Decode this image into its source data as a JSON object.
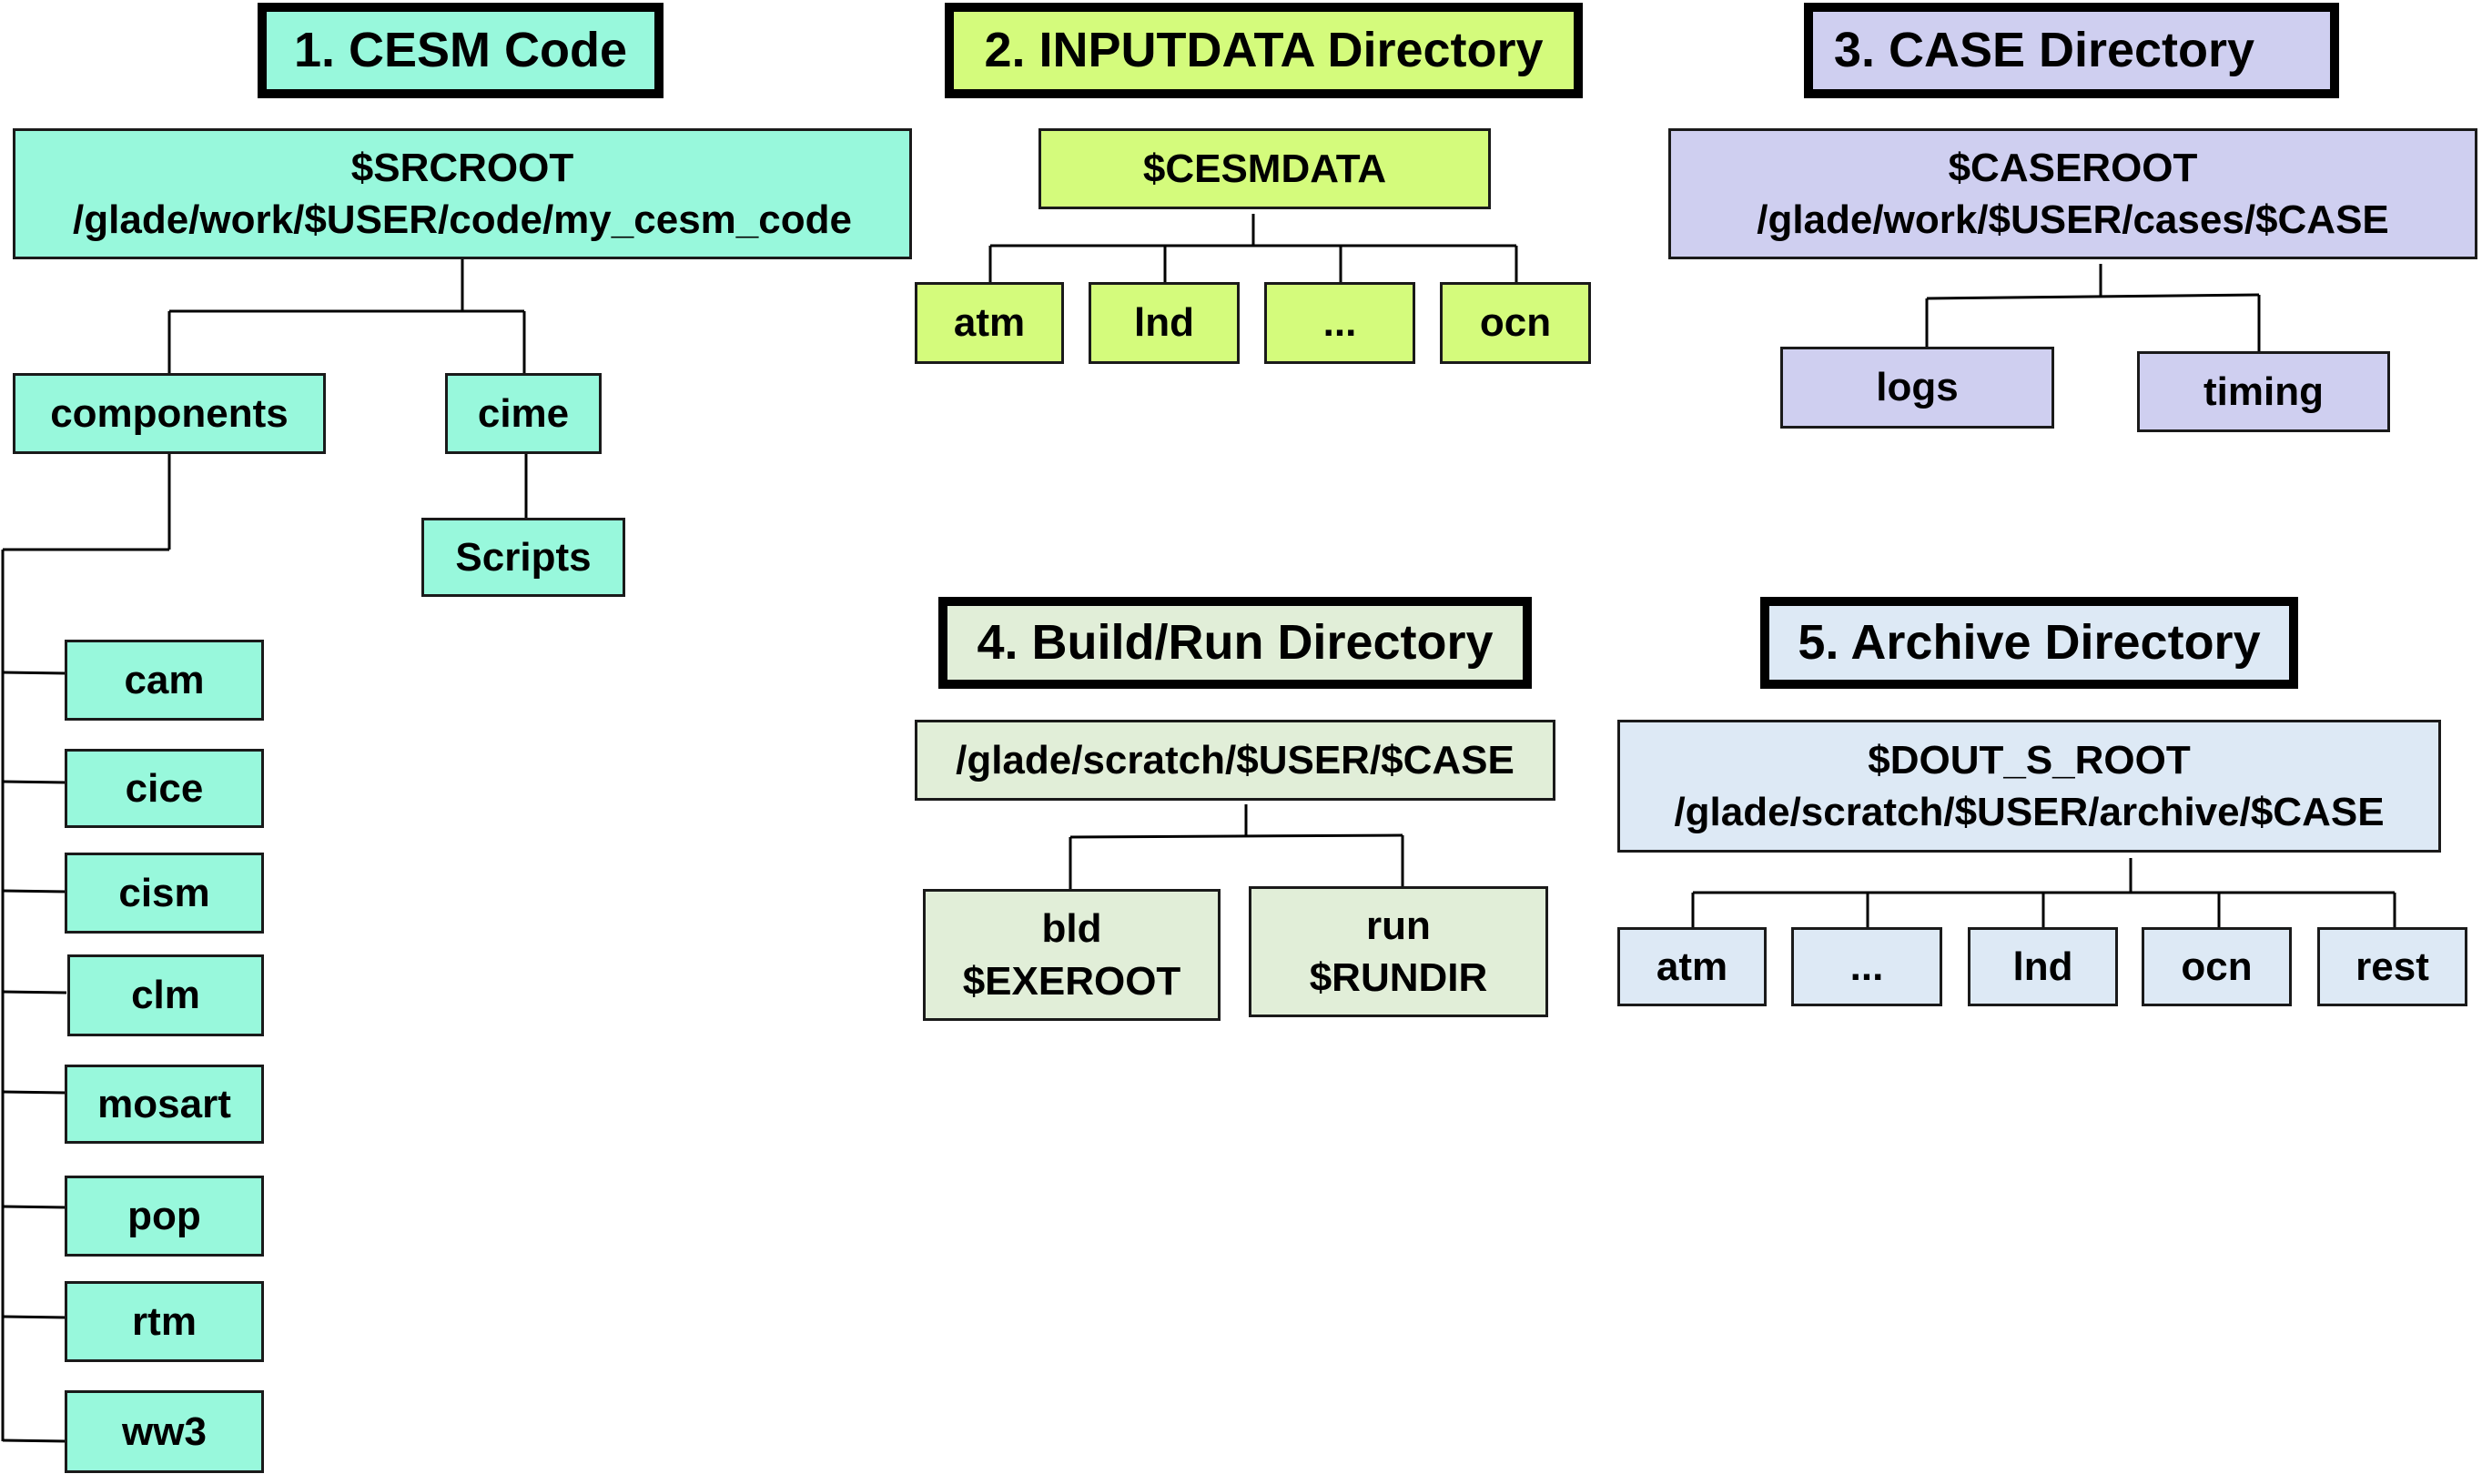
{
  "sections": {
    "cesm_code": {
      "title": "1. CESM Code",
      "root": {
        "var": "$SRCROOT",
        "path": "/glade/work/$USER/code/my_cesm_code"
      },
      "components": {
        "label": "components",
        "children": [
          "cam",
          "cice",
          "cism",
          "clm",
          "mosart",
          "pop",
          "rtm",
          "ww3"
        ]
      },
      "cime": {
        "label": "cime",
        "children": [
          "Scripts"
        ]
      },
      "color": "#98f8dc"
    },
    "inputdata": {
      "title": "2. INPUTDATA Directory",
      "root": {
        "var": "$CESMDATA"
      },
      "children": [
        "atm",
        "lnd",
        "...",
        "ocn"
      ],
      "color": "#d4fb7c"
    },
    "case": {
      "title": "3. CASE Directory",
      "root": {
        "var": "$CASEROOT",
        "path": "/glade/work/$USER/cases/$CASE"
      },
      "children": [
        "logs",
        "timing"
      ],
      "color": "#cfcff0"
    },
    "build_run": {
      "title": "4. Build/Run Directory",
      "root": {
        "path": "/glade/scratch/$USER/$CASE"
      },
      "children": [
        {
          "name": "bld",
          "var": "$EXEROOT"
        },
        {
          "name": "run",
          "var": "$RUNDIR"
        }
      ],
      "color": "#e1eed8"
    },
    "archive": {
      "title": "5. Archive Directory",
      "root": {
        "var": "$DOUT_S_ROOT",
        "path": "/glade/scratch/$USER/archive/$CASE"
      },
      "children": [
        "atm",
        "...",
        "lnd",
        "ocn",
        "rest"
      ],
      "color": "#dde9f5"
    }
  }
}
